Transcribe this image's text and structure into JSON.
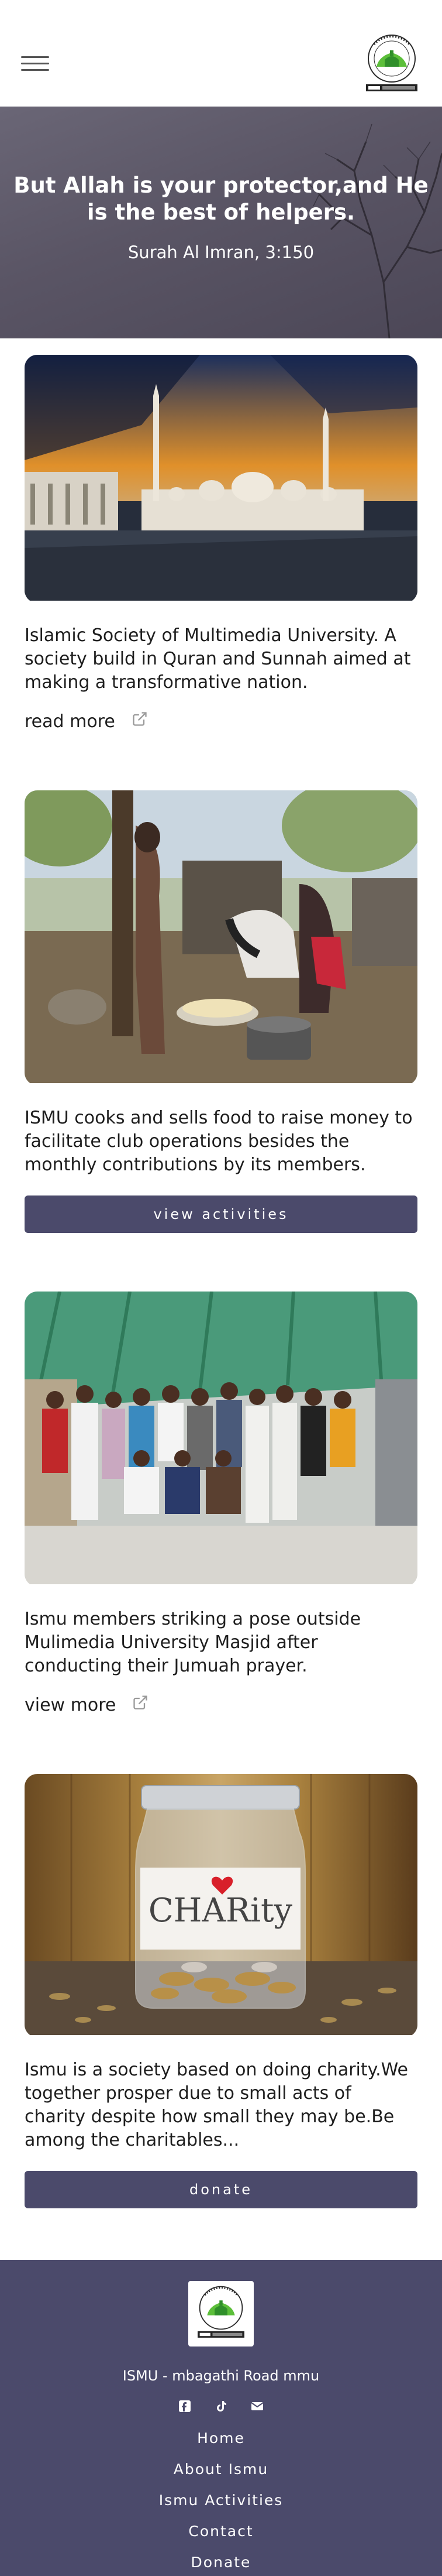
{
  "header": {
    "menu_icon": "hamburger-menu-icon",
    "logo_icon": "ismu-logo-icon"
  },
  "hero": {
    "quote": "But Allah is your protector,and He is the best of helpers.",
    "reference": "Surah Al Imran, 3:150"
  },
  "cards": [
    {
      "image_icon": "mosque-photo",
      "text": "Islamic Society of Multimedia University. A society build in Quran and Sunnah aimed at making a transformative nation.",
      "link_label": "read more",
      "link_icon": "external-link-icon"
    },
    {
      "image_icon": "cooking-photo",
      "text": "ISMU cooks and sells food to raise money to facilitate club operations besides the monthly contributions by its members.",
      "button_label": "view activities"
    },
    {
      "image_icon": "group-photo",
      "text": "Ismu members striking a pose outside Mulimedia University Masjid after conducting their Jumuah prayer.",
      "link_label": "view more",
      "link_icon": "external-link-icon"
    },
    {
      "image_icon": "charity-jar-photo",
      "jar_label": "CHARity",
      "text": "Ismu is a society based on doing charity.We together prosper due to small acts of charity despite how small they may be.Be among the charitables...",
      "button_label": "donate"
    }
  ],
  "footer": {
    "address": "ISMU - mbagathi Road mmu",
    "socials": [
      "facebook-icon",
      "tiktok-icon",
      "email-icon"
    ],
    "nav": [
      "Home",
      "About Ismu",
      "Ismu Activities",
      "Contact",
      "Donate"
    ]
  },
  "colors": {
    "accent": "#4b4a6b",
    "hero_overlay": "#5a5565",
    "text": "#1e1e1e"
  }
}
